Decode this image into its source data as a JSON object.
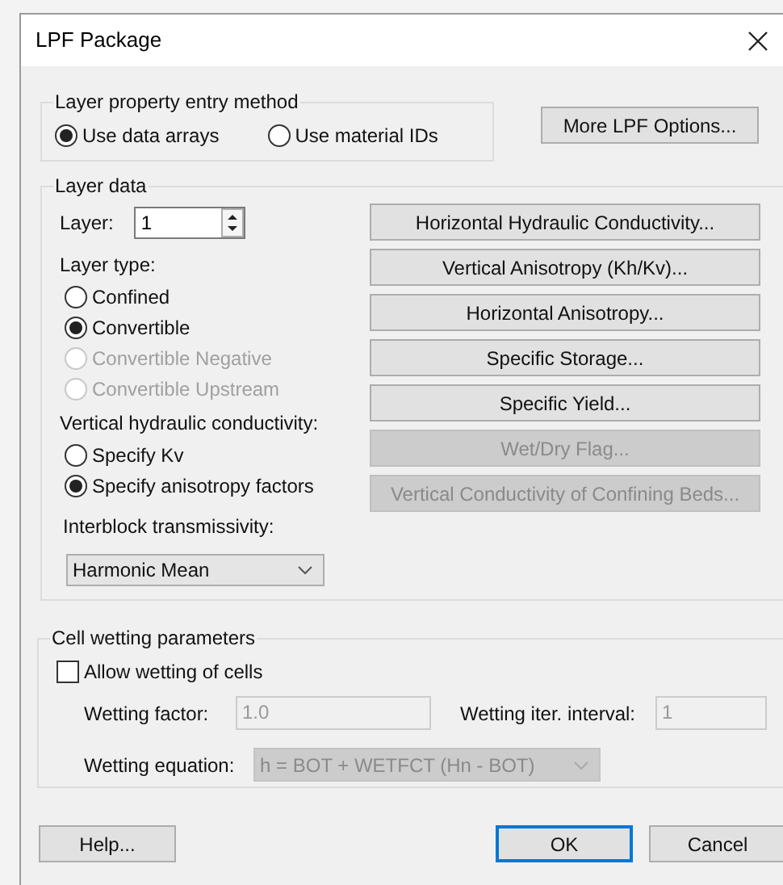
{
  "window": {
    "title": "LPF Package"
  },
  "entry_method": {
    "label": "Layer property entry method",
    "options": [
      {
        "label": "Use data arrays",
        "selected": true
      },
      {
        "label": "Use material IDs",
        "selected": false
      }
    ],
    "more_button": "More LPF Options..."
  },
  "layer_data": {
    "label": "Layer data",
    "layer_label": "Layer:",
    "layer_value": "1",
    "layer_type_label": "Layer type:",
    "layer_types": [
      {
        "label": "Confined",
        "selected": false,
        "disabled": false
      },
      {
        "label": "Convertible",
        "selected": true,
        "disabled": false
      },
      {
        "label": "Convertible Negative",
        "selected": false,
        "disabled": true
      },
      {
        "label": "Convertible Upstream",
        "selected": false,
        "disabled": true
      }
    ],
    "vk_label": "Vertical hydraulic conductivity:",
    "vk_options": [
      {
        "label": "Specify Kv",
        "selected": false,
        "disabled": false
      },
      {
        "label": "Specify anisotropy factors",
        "selected": true,
        "disabled": false
      }
    ],
    "interblock_label": "Interblock transmissivity:",
    "interblock_value": "Harmonic Mean",
    "buttons": [
      {
        "label": "Horizontal Hydraulic Conductivity...",
        "disabled": false
      },
      {
        "label": "Vertical Anisotropy (Kh/Kv)...",
        "disabled": false
      },
      {
        "label": "Horizontal Anisotropy...",
        "disabled": false
      },
      {
        "label": "Specific Storage...",
        "disabled": false
      },
      {
        "label": "Specific Yield...",
        "disabled": false
      },
      {
        "label": "Wet/Dry Flag...",
        "disabled": true
      },
      {
        "label": "Vertical Conductivity of Confining Beds...",
        "disabled": true
      }
    ]
  },
  "cell_wetting": {
    "label": "Cell wetting parameters",
    "allow": {
      "label": "Allow wetting of cells",
      "checked": false
    },
    "disabled": true,
    "factor_label": "Wetting factor:",
    "factor_value": "1.0",
    "interval_label": "Wetting iter. interval:",
    "interval_value": "1",
    "equation_label": "Wetting equation:",
    "equation_value": "h = BOT + WETFCT (Hn - BOT)"
  },
  "footer_buttons": [
    {
      "label": "Help...",
      "default": false
    },
    {
      "label": "OK",
      "default": true
    },
    {
      "label": "Cancel",
      "default": false
    }
  ]
}
